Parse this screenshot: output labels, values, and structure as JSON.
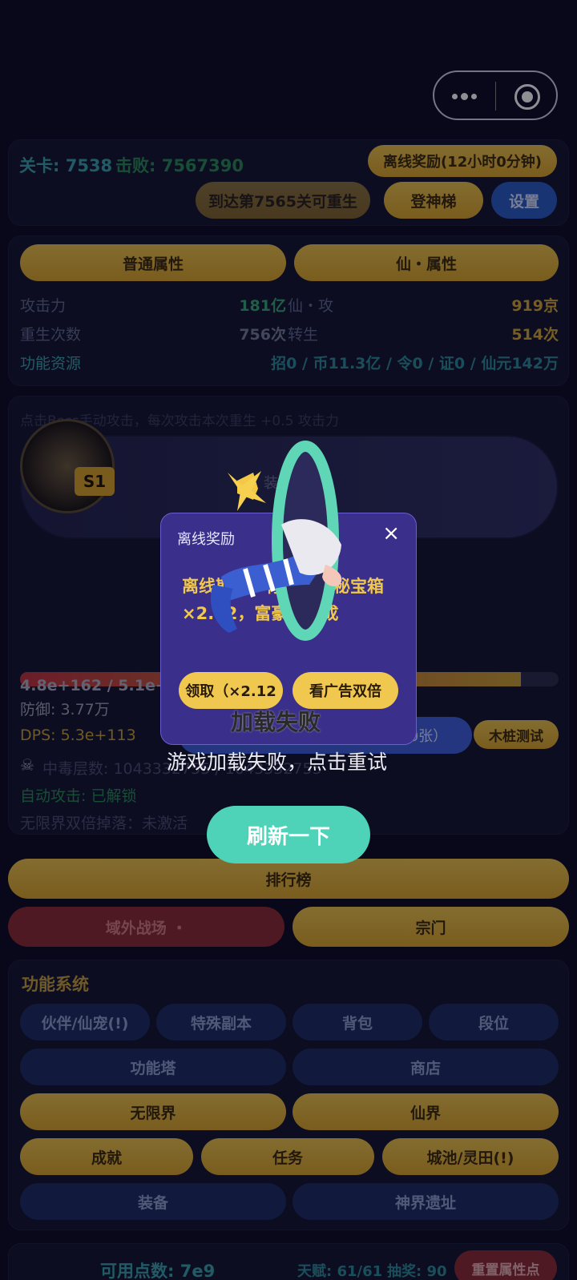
{
  "header": {
    "more_icon": "more-dots-icon",
    "close_icon": "record-icon"
  },
  "top": {
    "level_label": "关卡: 7538",
    "defeat_label": "击败: 7567390",
    "offline_reward_btn": "离线奖励(12小时0分钟)",
    "rebirth_btn": "到达第7565关可重生",
    "ladder_btn": "登神梯",
    "settings_btn": "设置"
  },
  "attr": {
    "tab_normal": "普通属性",
    "tab_immortal": "仙・属性",
    "rows": [
      {
        "l1": "攻击力",
        "v1": "181亿",
        "l2": "仙・攻",
        "v2": "919京"
      },
      {
        "l1": "重生次数",
        "v1": "756次",
        "l2": "转生",
        "v2": "514次"
      }
    ],
    "resources_label": "功能资源",
    "resources_value": "招0 / 币11.3亿 / 令0 / 证0 / 仙元142万"
  },
  "battle": {
    "hint": "点击Boss手动攻击，每次攻击本次重生 +0.5 攻击力",
    "rank_badge": "S1",
    "equip_hint": "装",
    "hp_text": "4.8e+162 / 5.1e+162",
    "defense": "防御: 3.77万",
    "dps": "DPS: 5.3e+113",
    "double_drop_btn": "双倍掉落卡不足（需12张，持有0张）",
    "dummy_btn": "木桩测试",
    "poison": "中毒层数: 1043332755 / 1043332755",
    "auto_attack": "自动攻击: 已解锁",
    "infinite_double": "无限界双倍掉落：未激活"
  },
  "bars": {
    "rank": "排行榜",
    "outer_battle": "域外战场 ・",
    "sect": "宗门"
  },
  "features": {
    "title": "功能系统",
    "row1": [
      "伙伴/仙宠(!)",
      "特殊副本",
      "背包",
      "段位"
    ],
    "row2": [
      "功能塔",
      "商店"
    ],
    "row3": [
      "无限界",
      "仙界"
    ],
    "row4": [
      "成就",
      "任务",
      "城池/灵田(!)"
    ],
    "row5": [
      "装备",
      "神界遗址"
    ]
  },
  "bottom": {
    "points": "可用点数: 7e9",
    "talent": "天赋: 61/61",
    "lottery": "抽奖: 90",
    "reset_btn": "重置属性点"
  },
  "modal": {
    "title": "离线奖励",
    "close": "×",
    "text": "离线期间，你获得神秘宝箱 ×2.12，富豪龙加成",
    "claim_btn": "领取（×2.12",
    "ad_btn": "看广告双倍"
  },
  "error": {
    "title": "加载失败",
    "message": "游戏加载失败，点击重试",
    "refresh_btn": "刷新一下"
  }
}
